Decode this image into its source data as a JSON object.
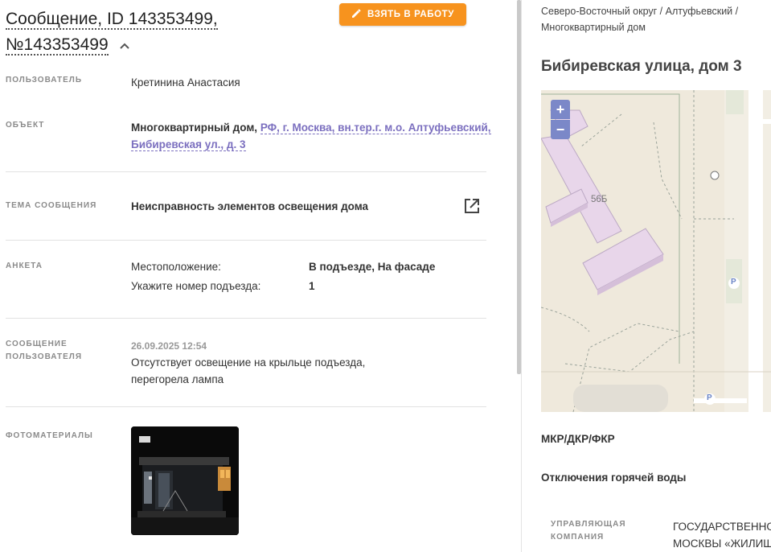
{
  "message": {
    "title_line1": "Сообщение, ID 143353499,",
    "title_line2": "№143353499",
    "take_button": "ВЗЯТЬ В РАБОТУ"
  },
  "fields": {
    "user_label": "ПОЛЬЗОВАТЕЛЬ",
    "user_value": "Кретинина Анастасия",
    "object_label": "ОБЪЕКТ",
    "object_type": "Многоквартирный дом,",
    "object_address_line1": "РФ, г. Москва, вн.тер.г. м.о. Алтуфьевский,",
    "object_address_line2": "Бибиревская ул., д. 3",
    "topic_label": "ТЕМА СООБЩЕНИЯ",
    "topic_value": "Неисправность элементов освещения дома",
    "survey_label": "АНКЕТА",
    "survey_rows": [
      {
        "q": "Местоположение:",
        "a": "В подъезде, На фасаде"
      },
      {
        "q": "Укажите номер подъезда:",
        "a": "1"
      }
    ],
    "user_message_label_1": "СООБЩЕНИЕ",
    "user_message_label_2": "ПОЛЬЗОВАТЕЛЯ",
    "user_message_date": "26.09.2025 12:54",
    "user_message_line1": "Отсутствует освещение на крыльце подъезда,",
    "user_message_line2": "перегорела лампа",
    "photos_label": "ФОТОМАТЕРИАЛЫ"
  },
  "side": {
    "breadcrumb_line1": "Северо-Восточный округ / Алтуфьевский /",
    "breadcrumb_line2": "Многоквартирный дом",
    "address": "Бибиревская улица, дом 3",
    "map": {
      "zoom_in": "+",
      "zoom_out": "−",
      "building_label": "56Б",
      "parking_label": "P"
    },
    "section1": "МКР/ДКР/ФКР",
    "section2": "Отключения горячей воды",
    "mgmt_label_1": "УПРАВЛЯЮЩАЯ",
    "mgmt_label_2": "КОМПАНИЯ",
    "mgmt_value_1": "ГОСУДАРСТВЕННО",
    "mgmt_value_2": "МОСКВЫ «ЖИЛИЩ"
  },
  "colors": {
    "accent_orange": "#f7931e",
    "link_purple": "#7b6fbf",
    "map_bg": "#efe9dc"
  }
}
